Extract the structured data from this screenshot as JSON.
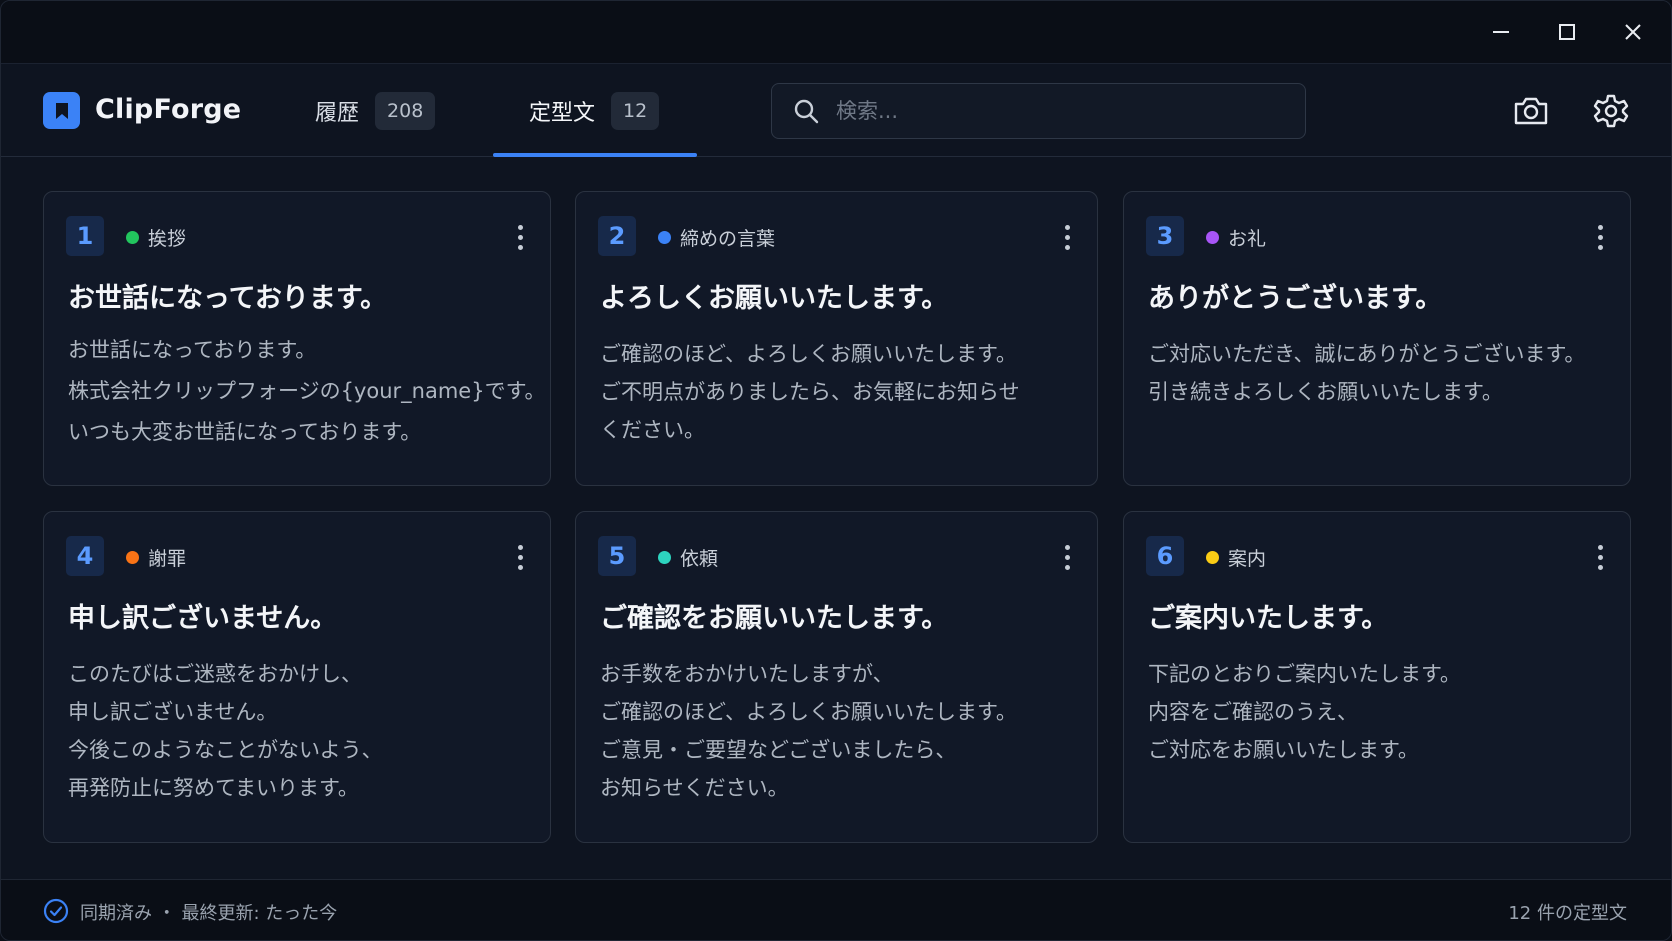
{
  "app": {
    "name": "ClipForge"
  },
  "tabs": [
    {
      "label": "履歴",
      "count": "208"
    },
    {
      "label": "定型文",
      "count": "12",
      "active": true
    }
  ],
  "search": {
    "placeholder": "検索..."
  },
  "header_icons": [
    "camera-icon",
    "gear-icon"
  ],
  "window_controls": [
    "minimize-icon",
    "maximize-icon",
    "close-icon"
  ],
  "cards": [
    {
      "number": "1",
      "category": "挨拶",
      "dot_color": "#22c55e",
      "title": "お世話になっております。",
      "lines": [
        "お世話になっております。",
        "株式会社クリップフォージの{your_name}です。",
        "いつも大変お世話になっております。"
      ]
    },
    {
      "number": "2",
      "category": "締めの言葉",
      "dot_color": "#3b82f6",
      "title": "よろしくお願いいたします。",
      "lines": [
        "ご確認のほど、よろしくお願いいたします。",
        "ご不明点がありましたら、お気軽にお知らせ",
        "ください。"
      ]
    },
    {
      "number": "3",
      "category": "お礼",
      "dot_color": "#a855f7",
      "title": "ありがとうございます。",
      "lines": [
        "ご対応いただき、誠にありがとうございます。",
        "引き続きよろしくお願いいたします。"
      ]
    },
    {
      "number": "4",
      "category": "謝罪",
      "dot_color": "#f97316",
      "title": "申し訳ございません。",
      "lines": [
        "このたびはご迷惑をおかけし、",
        "申し訳ございません。",
        "今後このようなことがないよう、",
        "再発防止に努めてまいります。"
      ]
    },
    {
      "number": "5",
      "category": "依頼",
      "dot_color": "#2dd4bf",
      "title": "ご確認をお願いいたします。",
      "lines": [
        "お手数をおかけいたしますが、",
        "ご確認のほど、よろしくお願いいたします。",
        "ご意見・ご要望などございましたら、",
        "お知らせください。"
      ]
    },
    {
      "number": "6",
      "category": "案内",
      "dot_color": "#facc15",
      "title": "ご案内いたします。",
      "lines": [
        "下記のとおりご案内いたします。",
        "内容をご確認のうえ、",
        "ご対応をお願いいたします。"
      ]
    }
  ],
  "status": {
    "sync": "同期済み ・ 最終更新: たった今",
    "count": "12 件の定型文"
  },
  "colors": {
    "accent": "#3b82f6",
    "background": "#0e1420",
    "card": "#111827"
  }
}
